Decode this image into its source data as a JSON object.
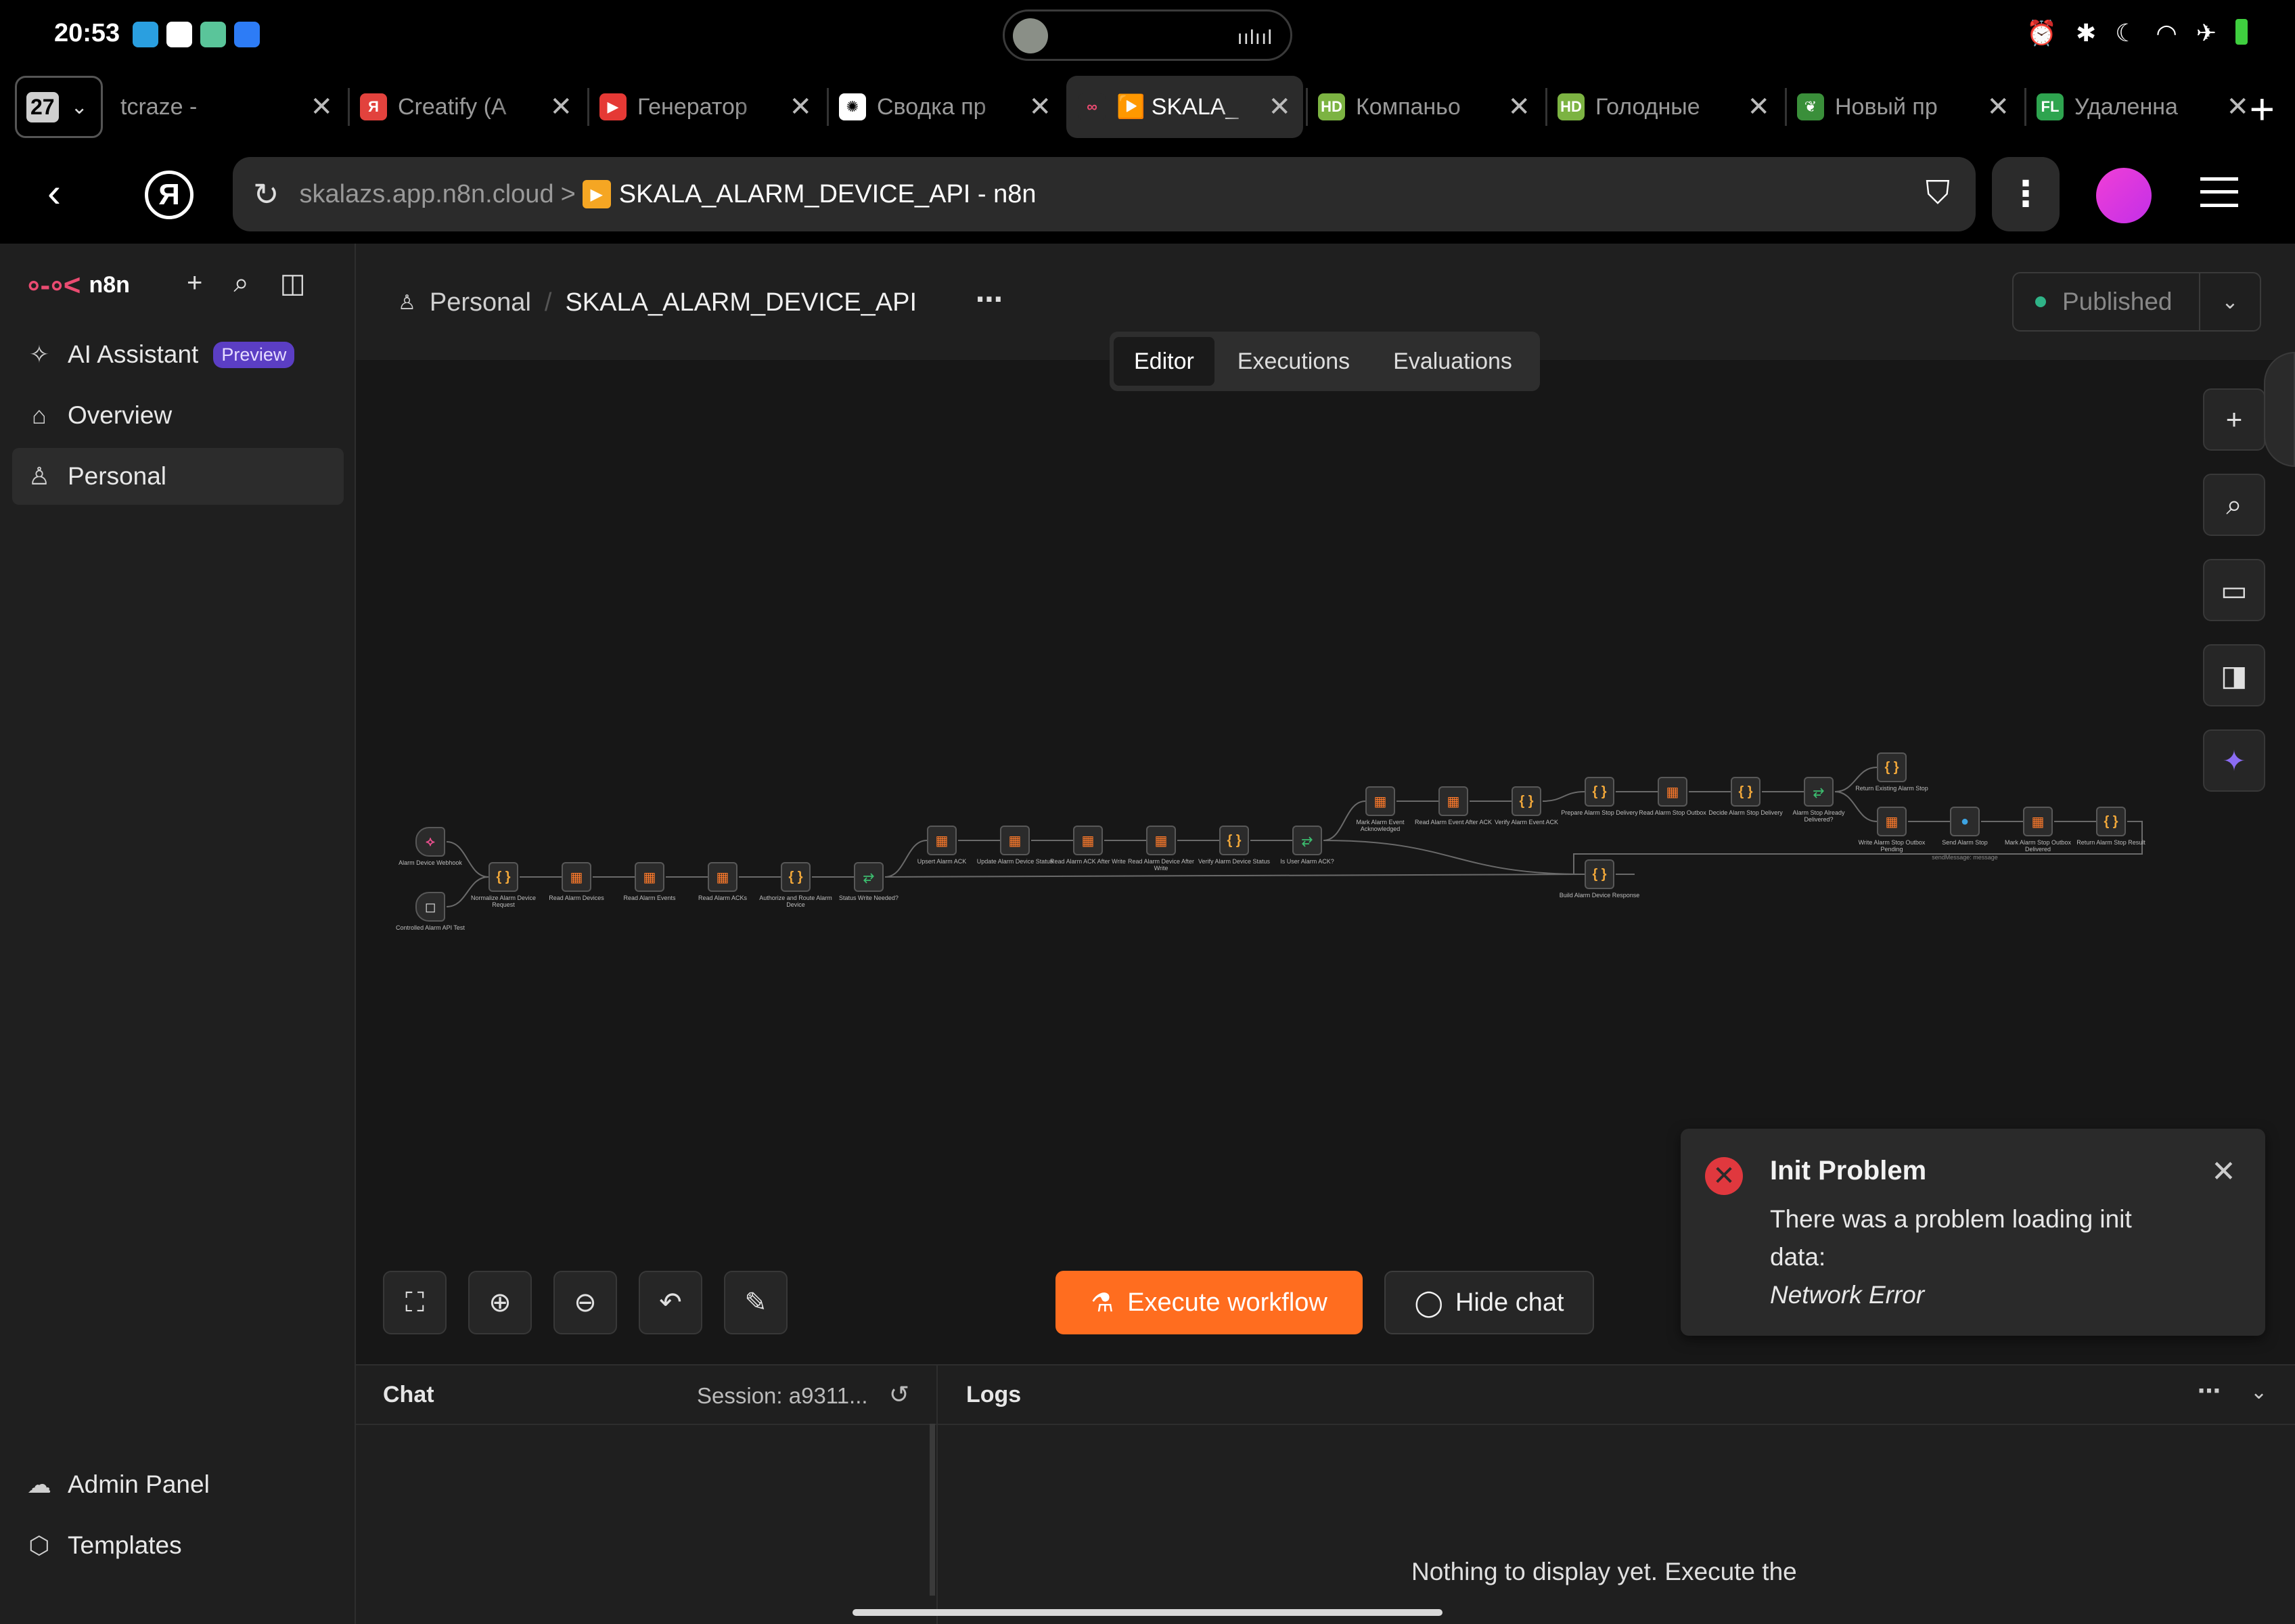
{
  "status_bar": {
    "time": "20:53"
  },
  "browser": {
    "tab_count": "27",
    "tabs": [
      {
        "title": "tcraze -",
        "favicon": "web-icon",
        "color": "#3a3a3a",
        "glyph": ""
      },
      {
        "title": "Creatify (A",
        "favicon": "yandex-icon",
        "color": "#e2423d",
        "glyph": "Я"
      },
      {
        "title": "Генератор",
        "favicon": "generator-icon",
        "color": "#e53935",
        "glyph": "▶"
      },
      {
        "title": "Сводка пр",
        "favicon": "openai-icon",
        "color": "#ffffff",
        "glyph": "✺"
      },
      {
        "title": "▶️ SKALA_",
        "favicon": "n8n-icon",
        "color": "#2b2b2b",
        "glyph": "∞"
      },
      {
        "title": "Компаньо",
        "favicon": "hh-icon",
        "color": "#7cb342",
        "glyph": "HD"
      },
      {
        "title": "Голодные",
        "favicon": "hh-icon",
        "color": "#7cb342",
        "glyph": "HD"
      },
      {
        "title": "Новый пр",
        "favicon": "leaf-icon",
        "color": "#3a8f3a",
        "glyph": "❦"
      },
      {
        "title": "Удаленна",
        "favicon": "fl-icon",
        "color": "#2ea44f",
        "glyph": "FL"
      }
    ],
    "address": {
      "host": "skalazs.app.n8n.cloud",
      "separator": ">",
      "page_title": "SKALA_ALARM_DEVICE_API - n8n"
    }
  },
  "sidebar": {
    "brand": "n8n",
    "items": [
      {
        "label": "AI Assistant",
        "icon": "sparkle-icon",
        "badge": "Preview"
      },
      {
        "label": "Overview",
        "icon": "home-icon"
      },
      {
        "label": "Personal",
        "icon": "user-icon",
        "selected": true
      }
    ],
    "bottom_items": [
      {
        "label": "Admin Panel",
        "icon": "cloud-icon"
      },
      {
        "label": "Templates",
        "icon": "box-icon"
      }
    ]
  },
  "header": {
    "breadcrumb_project": "Personal",
    "breadcrumb_sep": "/",
    "workflow_name": "SKALA_ALARM_DEVICE_API",
    "status": "Published",
    "tabs": [
      "Editor",
      "Executions",
      "Evaluations"
    ],
    "active_tab": "Editor"
  },
  "canvas_controls": {
    "execute_label": "Execute workflow",
    "hide_chat_label": "Hide chat"
  },
  "workflow": {
    "nodes": [
      {
        "label": "Alarm Device Webhook",
        "kind": "trig"
      },
      {
        "label": "Controlled Alarm API Test",
        "kind": "chat"
      },
      {
        "label": "Normalize Alarm Device Request",
        "kind": "code"
      },
      {
        "label": "Read Alarm Devices",
        "kind": "tbl"
      },
      {
        "label": "Read Alarm Events",
        "kind": "tbl"
      },
      {
        "label": "Read Alarm ACKs",
        "kind": "tbl"
      },
      {
        "label": "Authorize and Route Alarm Device",
        "kind": "code"
      },
      {
        "label": "Status Write Needed?",
        "kind": "iff"
      },
      {
        "label": "Upsert Alarm ACK",
        "kind": "tbl"
      },
      {
        "label": "Update Alarm Device Status",
        "kind": "tbl"
      },
      {
        "label": "Read Alarm ACK After Write",
        "kind": "tbl"
      },
      {
        "label": "Read Alarm Device After Write",
        "kind": "tbl"
      },
      {
        "label": "Verify Alarm Device Status",
        "kind": "code"
      },
      {
        "label": "Is User Alarm ACK?",
        "kind": "iff"
      },
      {
        "label": "Mark Alarm Event Acknowledged",
        "kind": "tbl"
      },
      {
        "label": "Read Alarm Event After ACK",
        "kind": "tbl"
      },
      {
        "label": "Verify Alarm Event ACK",
        "kind": "code"
      },
      {
        "label": "Prepare Alarm Stop Delivery",
        "kind": "code"
      },
      {
        "label": "Read Alarm Stop Outbox",
        "kind": "tbl"
      },
      {
        "label": "Decide Alarm Stop Delivery",
        "kind": "code"
      },
      {
        "label": "Alarm Stop Already Delivered?",
        "kind": "iff"
      },
      {
        "label": "Return Existing Alarm Stop",
        "kind": "code"
      },
      {
        "label": "Write Alarm Stop Outbox Pending",
        "kind": "tbl"
      },
      {
        "label": "Send Alarm Stop",
        "kind": "tg"
      },
      {
        "label": "Mark Alarm Stop Outbox Delivered",
        "kind": "tbl"
      },
      {
        "label": "Return Alarm Stop Result",
        "kind": "code"
      },
      {
        "label": "Build Alarm Device Response",
        "kind": "code"
      }
    ],
    "send_sub": "sendMessage: message"
  },
  "toast": {
    "title": "Init Problem",
    "message": "There was a problem loading init data:",
    "detail": "Network Error"
  },
  "chat_panel": {
    "title": "Chat",
    "session": "Session: a9311..."
  },
  "logs_panel": {
    "title": "Logs",
    "empty": "Nothing to display yet. Execute the"
  }
}
